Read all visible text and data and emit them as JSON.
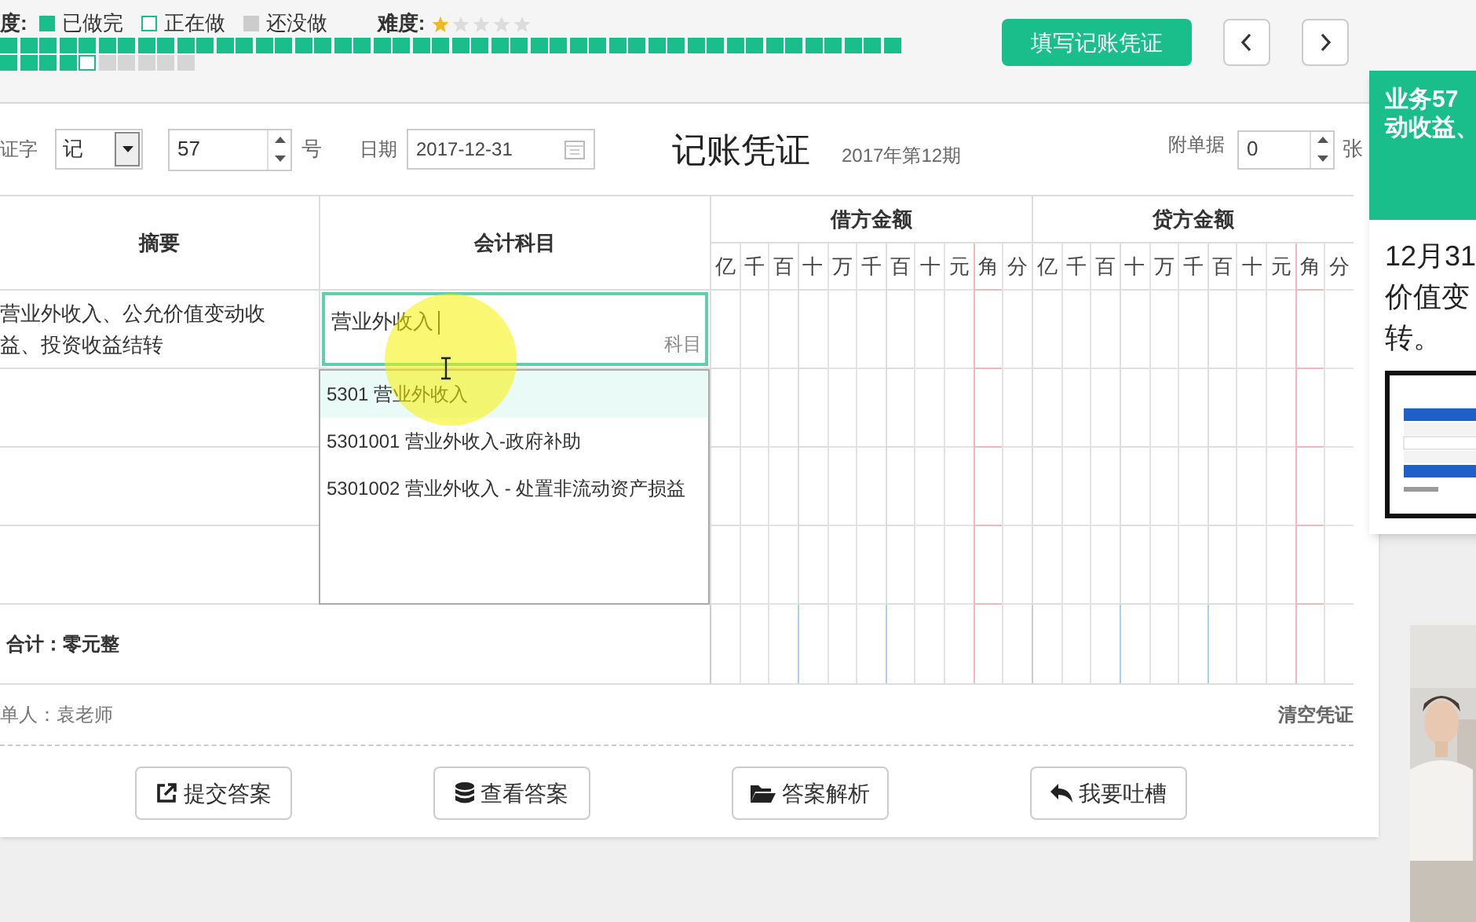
{
  "legend": {
    "prefix": "度:",
    "items": [
      {
        "kind": "done",
        "label": "已做完"
      },
      {
        "kind": "current",
        "label": "正在做"
      },
      {
        "kind": "todo",
        "label": "还没做"
      }
    ],
    "difficulty_label": "难度:",
    "stars": 1
  },
  "progress": [
    {
      "kind": "done"
    },
    {
      "kind": "done"
    },
    {
      "kind": "done"
    },
    {
      "kind": "done"
    },
    {
      "kind": "done"
    },
    {
      "kind": "done"
    },
    {
      "kind": "done"
    },
    {
      "kind": "done"
    },
    {
      "kind": "done"
    },
    {
      "kind": "done"
    },
    {
      "kind": "done"
    },
    {
      "kind": "done"
    },
    {
      "kind": "done"
    },
    {
      "kind": "done"
    },
    {
      "kind": "done"
    },
    {
      "kind": "done"
    },
    {
      "kind": "done"
    },
    {
      "kind": "done"
    },
    {
      "kind": "done"
    },
    {
      "kind": "done"
    },
    {
      "kind": "done"
    },
    {
      "kind": "done"
    },
    {
      "kind": "done"
    },
    {
      "kind": "done"
    },
    {
      "kind": "done"
    },
    {
      "kind": "done"
    },
    {
      "kind": "done"
    },
    {
      "kind": "done"
    },
    {
      "kind": "done"
    },
    {
      "kind": "done"
    },
    {
      "kind": "done"
    },
    {
      "kind": "done"
    },
    {
      "kind": "done"
    },
    {
      "kind": "done"
    },
    {
      "kind": "done"
    },
    {
      "kind": "done"
    },
    {
      "kind": "done"
    },
    {
      "kind": "done"
    },
    {
      "kind": "done"
    },
    {
      "kind": "done"
    },
    {
      "kind": "done"
    },
    {
      "kind": "done"
    },
    {
      "kind": "done"
    },
    {
      "kind": "done"
    },
    {
      "kind": "done"
    },
    {
      "kind": "done"
    },
    {
      "kind": "done"
    },
    {
      "kind": "done"
    },
    {
      "kind": "done"
    },
    {
      "kind": "done"
    },
    {
      "kind": "current"
    },
    {
      "kind": "todo"
    },
    {
      "kind": "todo"
    },
    {
      "kind": "todo"
    },
    {
      "kind": "todo"
    },
    {
      "kind": "todo"
    }
  ],
  "fill_button": "填写记账凭证",
  "voucher": {
    "word_label": "证字",
    "word_value": "记",
    "number_value": "57",
    "number_suffix": "号",
    "date_label": "日期",
    "date_value": "2017-12-31",
    "title": "记账凭证",
    "period": "2017年第12期",
    "attach_label": "附单据",
    "attach_value": "0",
    "attach_suffix": "张",
    "columns": {
      "summary": "摘要",
      "account": "会计科目",
      "debit": "借方金额",
      "credit": "贷方金额"
    },
    "debit_digits": [
      "亿",
      "千",
      "百",
      "十",
      "万",
      "千",
      "百",
      "十",
      "元",
      "角",
      "分"
    ],
    "credit_digits": [
      "亿",
      "千",
      "百",
      "十",
      "万",
      "千",
      "百",
      "十",
      "元",
      "角",
      "分"
    ],
    "rows": [
      {
        "summary": "营业外收入、公允价值变动收益、投资收益结转",
        "account": "营业外收入",
        "account_hint": "科目"
      },
      {},
      {},
      {}
    ],
    "suggestions": [
      {
        "label": "5301 营业外收入",
        "selected": true
      },
      {
        "label": "5301001 营业外收入-政府补助",
        "selected": false
      },
      {
        "label": "5301002 营业外收入 - 处置非流动资产损益",
        "selected": false
      }
    ],
    "total": "合计：零元整",
    "maker": "单人：袁老师",
    "clear": "清空凭证"
  },
  "actions": [
    {
      "kind": "submit",
      "label": "提交答案"
    },
    {
      "kind": "view",
      "label": "查看答案"
    },
    {
      "kind": "explain",
      "label": "答案解析"
    },
    {
      "kind": "feedback",
      "label": "我要吐槽"
    }
  ],
  "task_panel": {
    "title_lines": [
      "业务57",
      "动收益、"
    ],
    "body_lines": [
      "12月31",
      "价值变",
      "转。"
    ],
    "image": {
      "kind": "picture"
    }
  },
  "video": {
    "kind": "picture"
  }
}
